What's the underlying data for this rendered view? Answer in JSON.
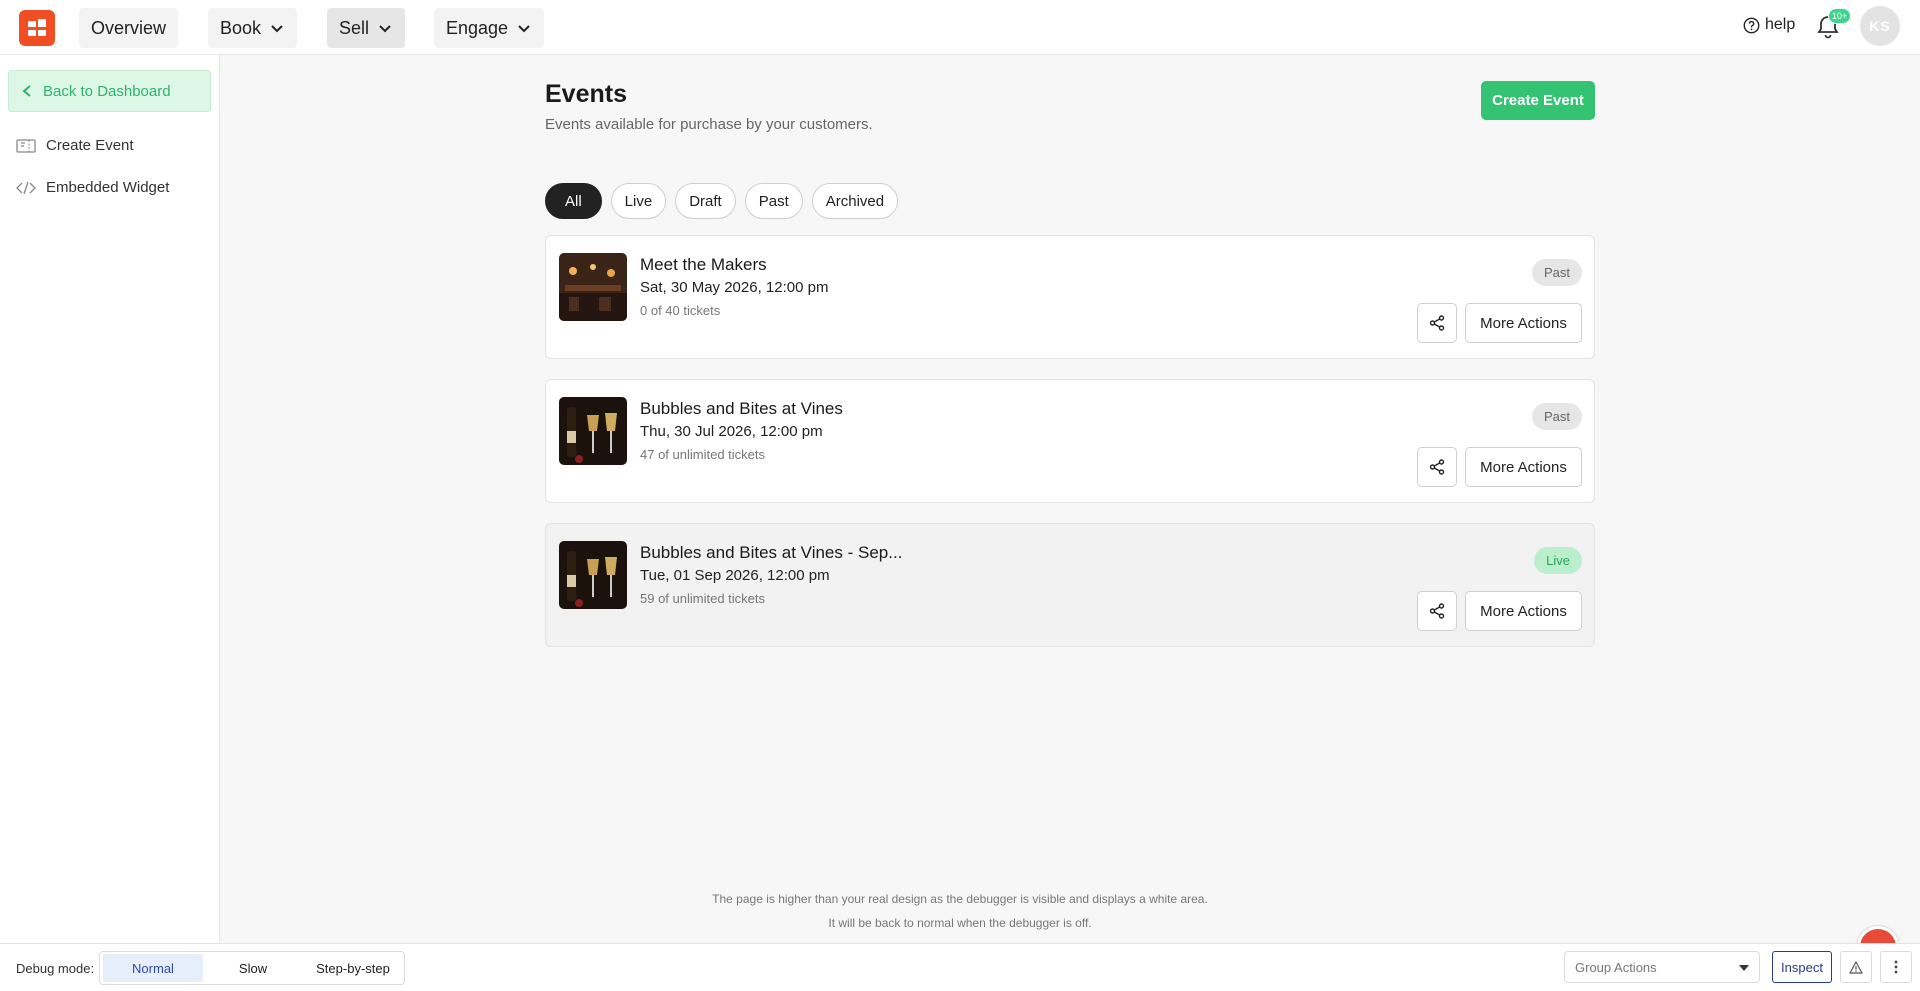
{
  "nav": {
    "items": [
      {
        "label": "Overview"
      },
      {
        "label": "Book"
      },
      {
        "label": "Sell"
      },
      {
        "label": "Engage"
      }
    ],
    "help_label": "help",
    "notification_count": "10+",
    "avatar_initials": "KS"
  },
  "sidebar": {
    "back_label": "Back to Dashboard",
    "items": [
      {
        "label": "Create Event",
        "icon": "ticket-icon"
      },
      {
        "label": "Embedded Widget",
        "icon": "code-icon"
      }
    ]
  },
  "main": {
    "title": "Events",
    "subtitle": "Events available for purchase by your customers.",
    "create_button": "Create Event",
    "filters": [
      "All",
      "Live",
      "Draft",
      "Past",
      "Archived"
    ],
    "active_filter": "All",
    "events": [
      {
        "title": "Meet the Makers",
        "date": "Sat, 30 May 2026, 12:00 pm",
        "tickets": "0 of 40 tickets",
        "status": "Past",
        "more_label": "More Actions"
      },
      {
        "title": "Bubbles and Bites at Vines",
        "date": "Thu, 30 Jul 2026, 12:00 pm",
        "tickets": "47 of unlimited tickets",
        "status": "Past",
        "more_label": "More Actions"
      },
      {
        "title": "Bubbles and Bites at Vines - Sep...",
        "date": "Tue, 01 Sep 2026, 12:00 pm",
        "tickets": "59 of unlimited tickets",
        "status": "Live",
        "more_label": "More Actions"
      }
    ],
    "debug_note_1": "The page is higher than your real design as the debugger is visible and displays a white area.",
    "debug_note_2": "It will be back to normal when the debugger is off."
  },
  "debugbar": {
    "label": "Debug mode:",
    "modes": [
      "Normal",
      "Slow",
      "Step-by-step"
    ],
    "active_mode": "Normal",
    "group_actions_placeholder": "Group Actions",
    "inspect_label": "Inspect"
  },
  "colors": {
    "brand": "#f04e23",
    "accent_green": "#34c273",
    "live_badge_bg": "#b9efcd"
  }
}
